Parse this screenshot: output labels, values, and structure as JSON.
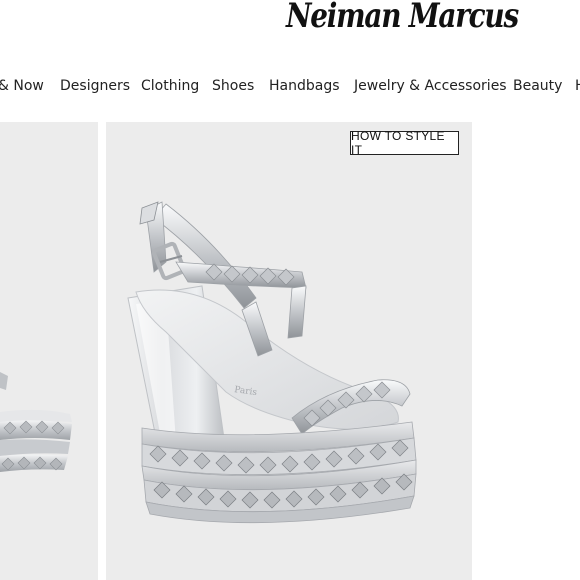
{
  "header": {
    "logo_text": "Neiman Marcus"
  },
  "nav": {
    "items": [
      {
        "label": "& Now"
      },
      {
        "label": "Designers"
      },
      {
        "label": "Clothing"
      },
      {
        "label": "Shoes"
      },
      {
        "label": "Handbags"
      },
      {
        "label": "Jewelry & Accessories"
      },
      {
        "label": "Beauty"
      },
      {
        "label": "H"
      }
    ]
  },
  "product": {
    "style_button_label": "HOW TO STYLE IT",
    "insole_logo_text": "Paris"
  },
  "colors": {
    "image_background": "#ececec",
    "metallic_silver": "#c9ccd0"
  }
}
